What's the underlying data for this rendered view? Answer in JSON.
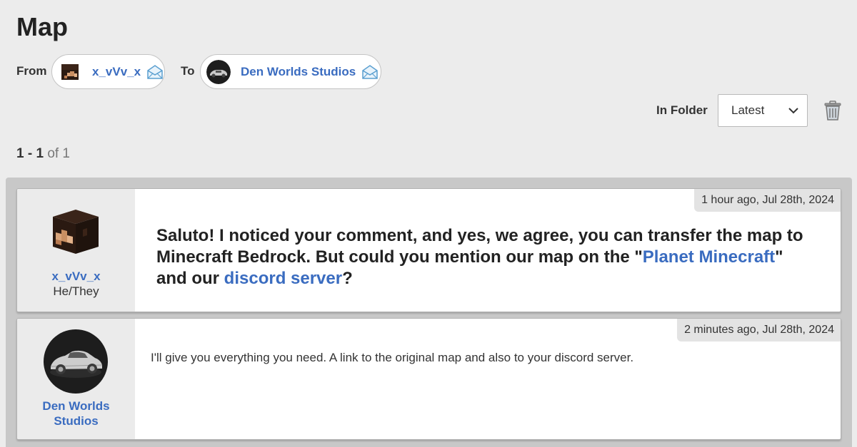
{
  "page": {
    "title": "Map"
  },
  "parties": {
    "from_label": "From",
    "from_name": "x_vVv_x",
    "to_label": "To",
    "to_name": "Den Worlds Studios"
  },
  "folder": {
    "label": "In Folder",
    "selected": "Latest"
  },
  "pagination": {
    "range": "1 - 1",
    "of_text": "of 1"
  },
  "icons": {
    "mail": "envelope-icon",
    "trash": "trash-icon",
    "dropdown": "chevron-down-icon"
  },
  "colors": {
    "link": "#3a6cc0",
    "background": "#ececec"
  },
  "messages": [
    {
      "time": "1 hour ago, Jul 28th, 2024",
      "author": "x_vVv_x",
      "pronouns": "He/They",
      "text_part1": "Saluto! I noticed your comment, and yes, we agree, you can transfer the map to Minecraft Bedrock. But could you mention our map on the \"",
      "link1": "Planet Minecraft",
      "text_part2": "\" and our ",
      "link2": "discord server",
      "text_part3": "?"
    },
    {
      "time": "2 minutes ago, Jul 28th, 2024",
      "author_line1": "Den Worlds",
      "author_line2": "Studios",
      "text": "I'll give you everything you need. A link to the original map and also to your discord server."
    }
  ]
}
